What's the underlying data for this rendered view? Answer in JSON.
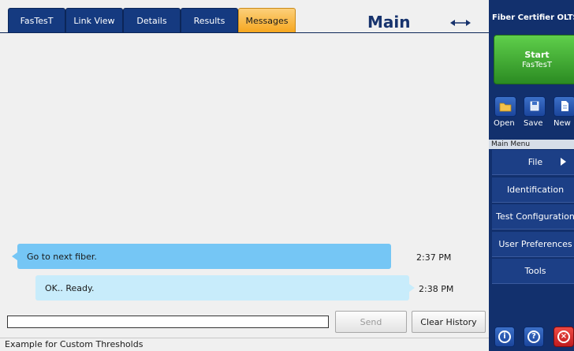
{
  "tabs": [
    {
      "label": "FasTesT"
    },
    {
      "label": "Link View"
    },
    {
      "label": "Details"
    },
    {
      "label": "Results"
    },
    {
      "label": "Messages",
      "active": true
    }
  ],
  "header": {
    "title": "Main"
  },
  "chat": {
    "messages": [
      {
        "text": "Go to next fiber.",
        "time": "2:37 PM"
      },
      {
        "text": "OK.. Ready.",
        "time": "2:38 PM"
      }
    ]
  },
  "composer": {
    "value": "",
    "send_label": "Send",
    "clear_label": "Clear History"
  },
  "status": {
    "text": "Example for Custom Thresholds"
  },
  "side": {
    "title": "Fiber Certifier OLTS",
    "start": {
      "line1": "Start",
      "line2": "FasTesT"
    },
    "file_buttons": {
      "open": "Open",
      "save": "Save",
      "new": "New"
    },
    "menu_title": "Main Menu",
    "menu": [
      {
        "label": "File",
        "submenu": true
      },
      {
        "label": "Identification"
      },
      {
        "label": "Test Configuration"
      },
      {
        "label": "User Preferences"
      },
      {
        "label": "Tools"
      }
    ]
  },
  "colors": {
    "tab_bg": "#153a80",
    "tab_active": "#f6a51c",
    "side_bg": "#12306d",
    "start_green": "#3fae31",
    "bubble_sent": "#75c6f5",
    "bubble_received": "#c8ecfb",
    "close_red": "#d8262a"
  },
  "icons": {
    "swap": "double-arrow-icon",
    "open": "folder-icon",
    "save": "floppy-disk-icon",
    "new": "document-icon",
    "info": "info-icon",
    "help": "help-icon",
    "close": "close-icon"
  }
}
